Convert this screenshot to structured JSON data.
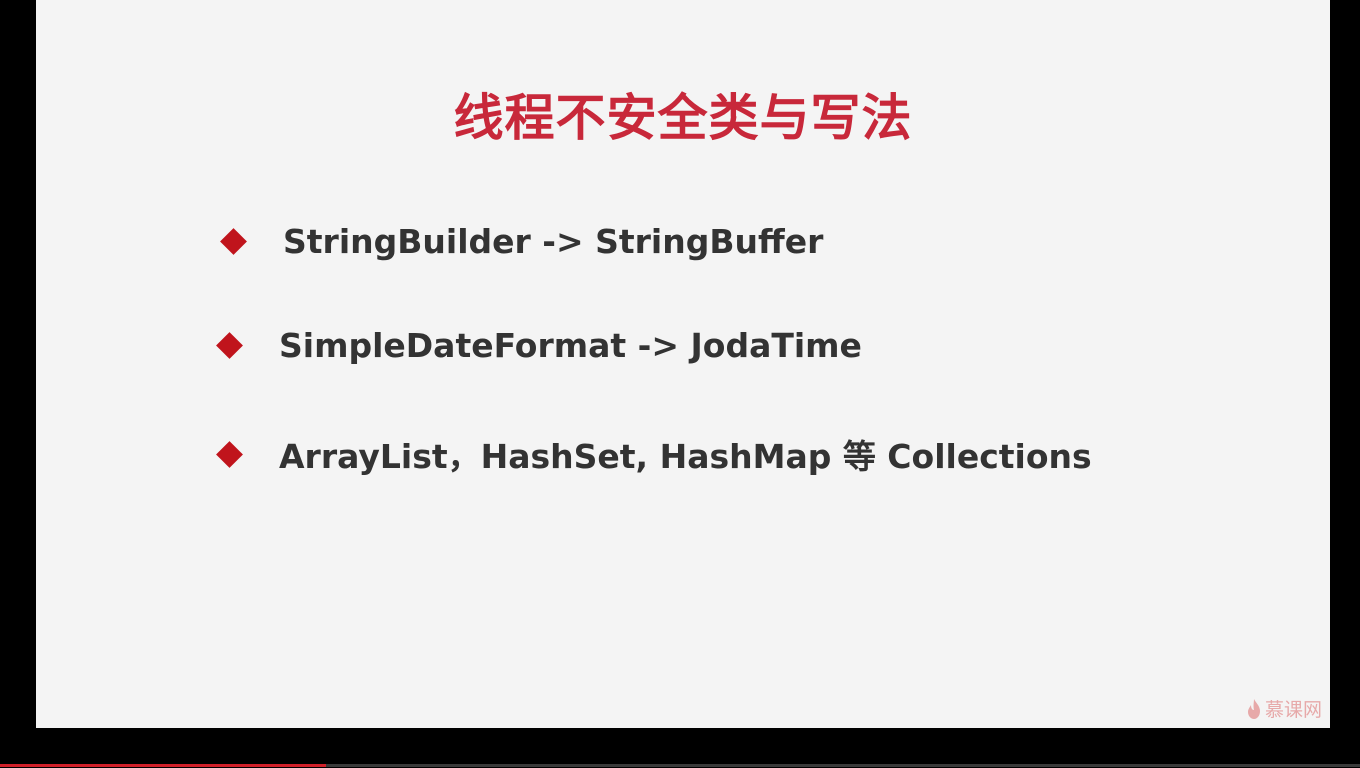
{
  "slide": {
    "title": "线程不安全类与写法",
    "bullets": [
      {
        "text": "StringBuilder -> StringBuffer",
        "icon": "diamond-bullet-icon"
      },
      {
        "text": "SimpleDateFormat -> JodaTime",
        "icon": "diamond-bullet-icon"
      },
      {
        "text": "ArrayList，HashSet, HashMap 等 Collections",
        "icon": "diamond-bullet-icon"
      }
    ],
    "watermark": {
      "text": "慕课网",
      "icon": "flame-logo-icon"
    }
  },
  "player": {
    "progress": 0.24
  },
  "colors": {
    "title": "#c8283a",
    "bullet": "#c0141c",
    "text": "#333333",
    "background": "#f4f4f4",
    "progress": "#d0202a"
  }
}
